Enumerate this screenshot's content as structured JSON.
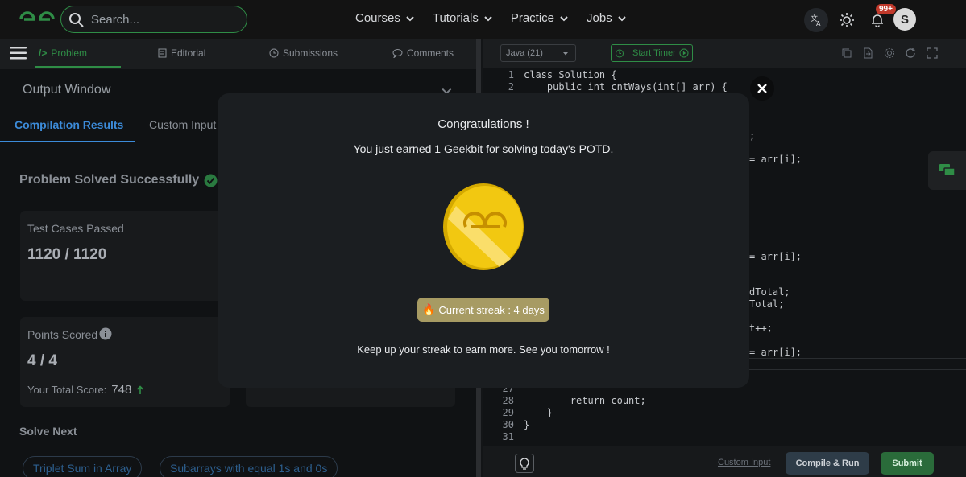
{
  "nav": {
    "search_placeholder": "Search...",
    "links": [
      "Courses",
      "Tutorials",
      "Practice",
      "Jobs"
    ],
    "notification_count": "99+",
    "avatar_initial": "S"
  },
  "left_tabs": {
    "problem": "Problem",
    "editorial": "Editorial",
    "submissions": "Submissions",
    "comments": "Comments"
  },
  "output": {
    "title": "Output Window",
    "tab_results": "Compilation Results",
    "tab_custom": "Custom Input",
    "status": "Problem Solved Successfully",
    "test_label": "Test Cases Passed",
    "test_value": "1120 / 1120",
    "points_label": "Points Scored",
    "points_value": "4 / 4",
    "total_label": "Your Total Score:",
    "total_value": "748",
    "solve_next": "Solve Next",
    "suggestions": [
      "Triplet Sum in Array",
      "Subarrays with equal 1s and 0s"
    ]
  },
  "editor": {
    "language": "Java (21)",
    "timer": "Start Timer",
    "lines": [
      {
        "n": "1",
        "code": "class Solution {"
      },
      {
        "n": "2",
        "code": "    public int cntWays(int[] arr) {"
      },
      {
        "n": "27",
        "code": ""
      },
      {
        "n": "28",
        "code": "        return count;"
      },
      {
        "n": "29",
        "code": "    }"
      },
      {
        "n": "30",
        "code": "}"
      },
      {
        "n": "31",
        "code": ""
      }
    ],
    "fragments": [
      ";",
      "= arr[i];",
      "= arr[i];",
      "dTotal;",
      "Total;",
      "t++;",
      "= arr[i];"
    ],
    "custom_input": "Custom Input",
    "compile_run": "Compile & Run",
    "submit": "Submit"
  },
  "modal": {
    "title": "Congratulations !",
    "subtitle": "You just earned 1 Geekbit for solving today's POTD.",
    "streak": "Current streak : 4 days",
    "footer": "Keep up your streak to earn more. See you tomorrow !"
  },
  "colors": {
    "brand_green": "#2f8d46",
    "link_blue": "#3c8bd9",
    "coin_gold": "#f2c811",
    "streak_bg": "#a79b63"
  }
}
